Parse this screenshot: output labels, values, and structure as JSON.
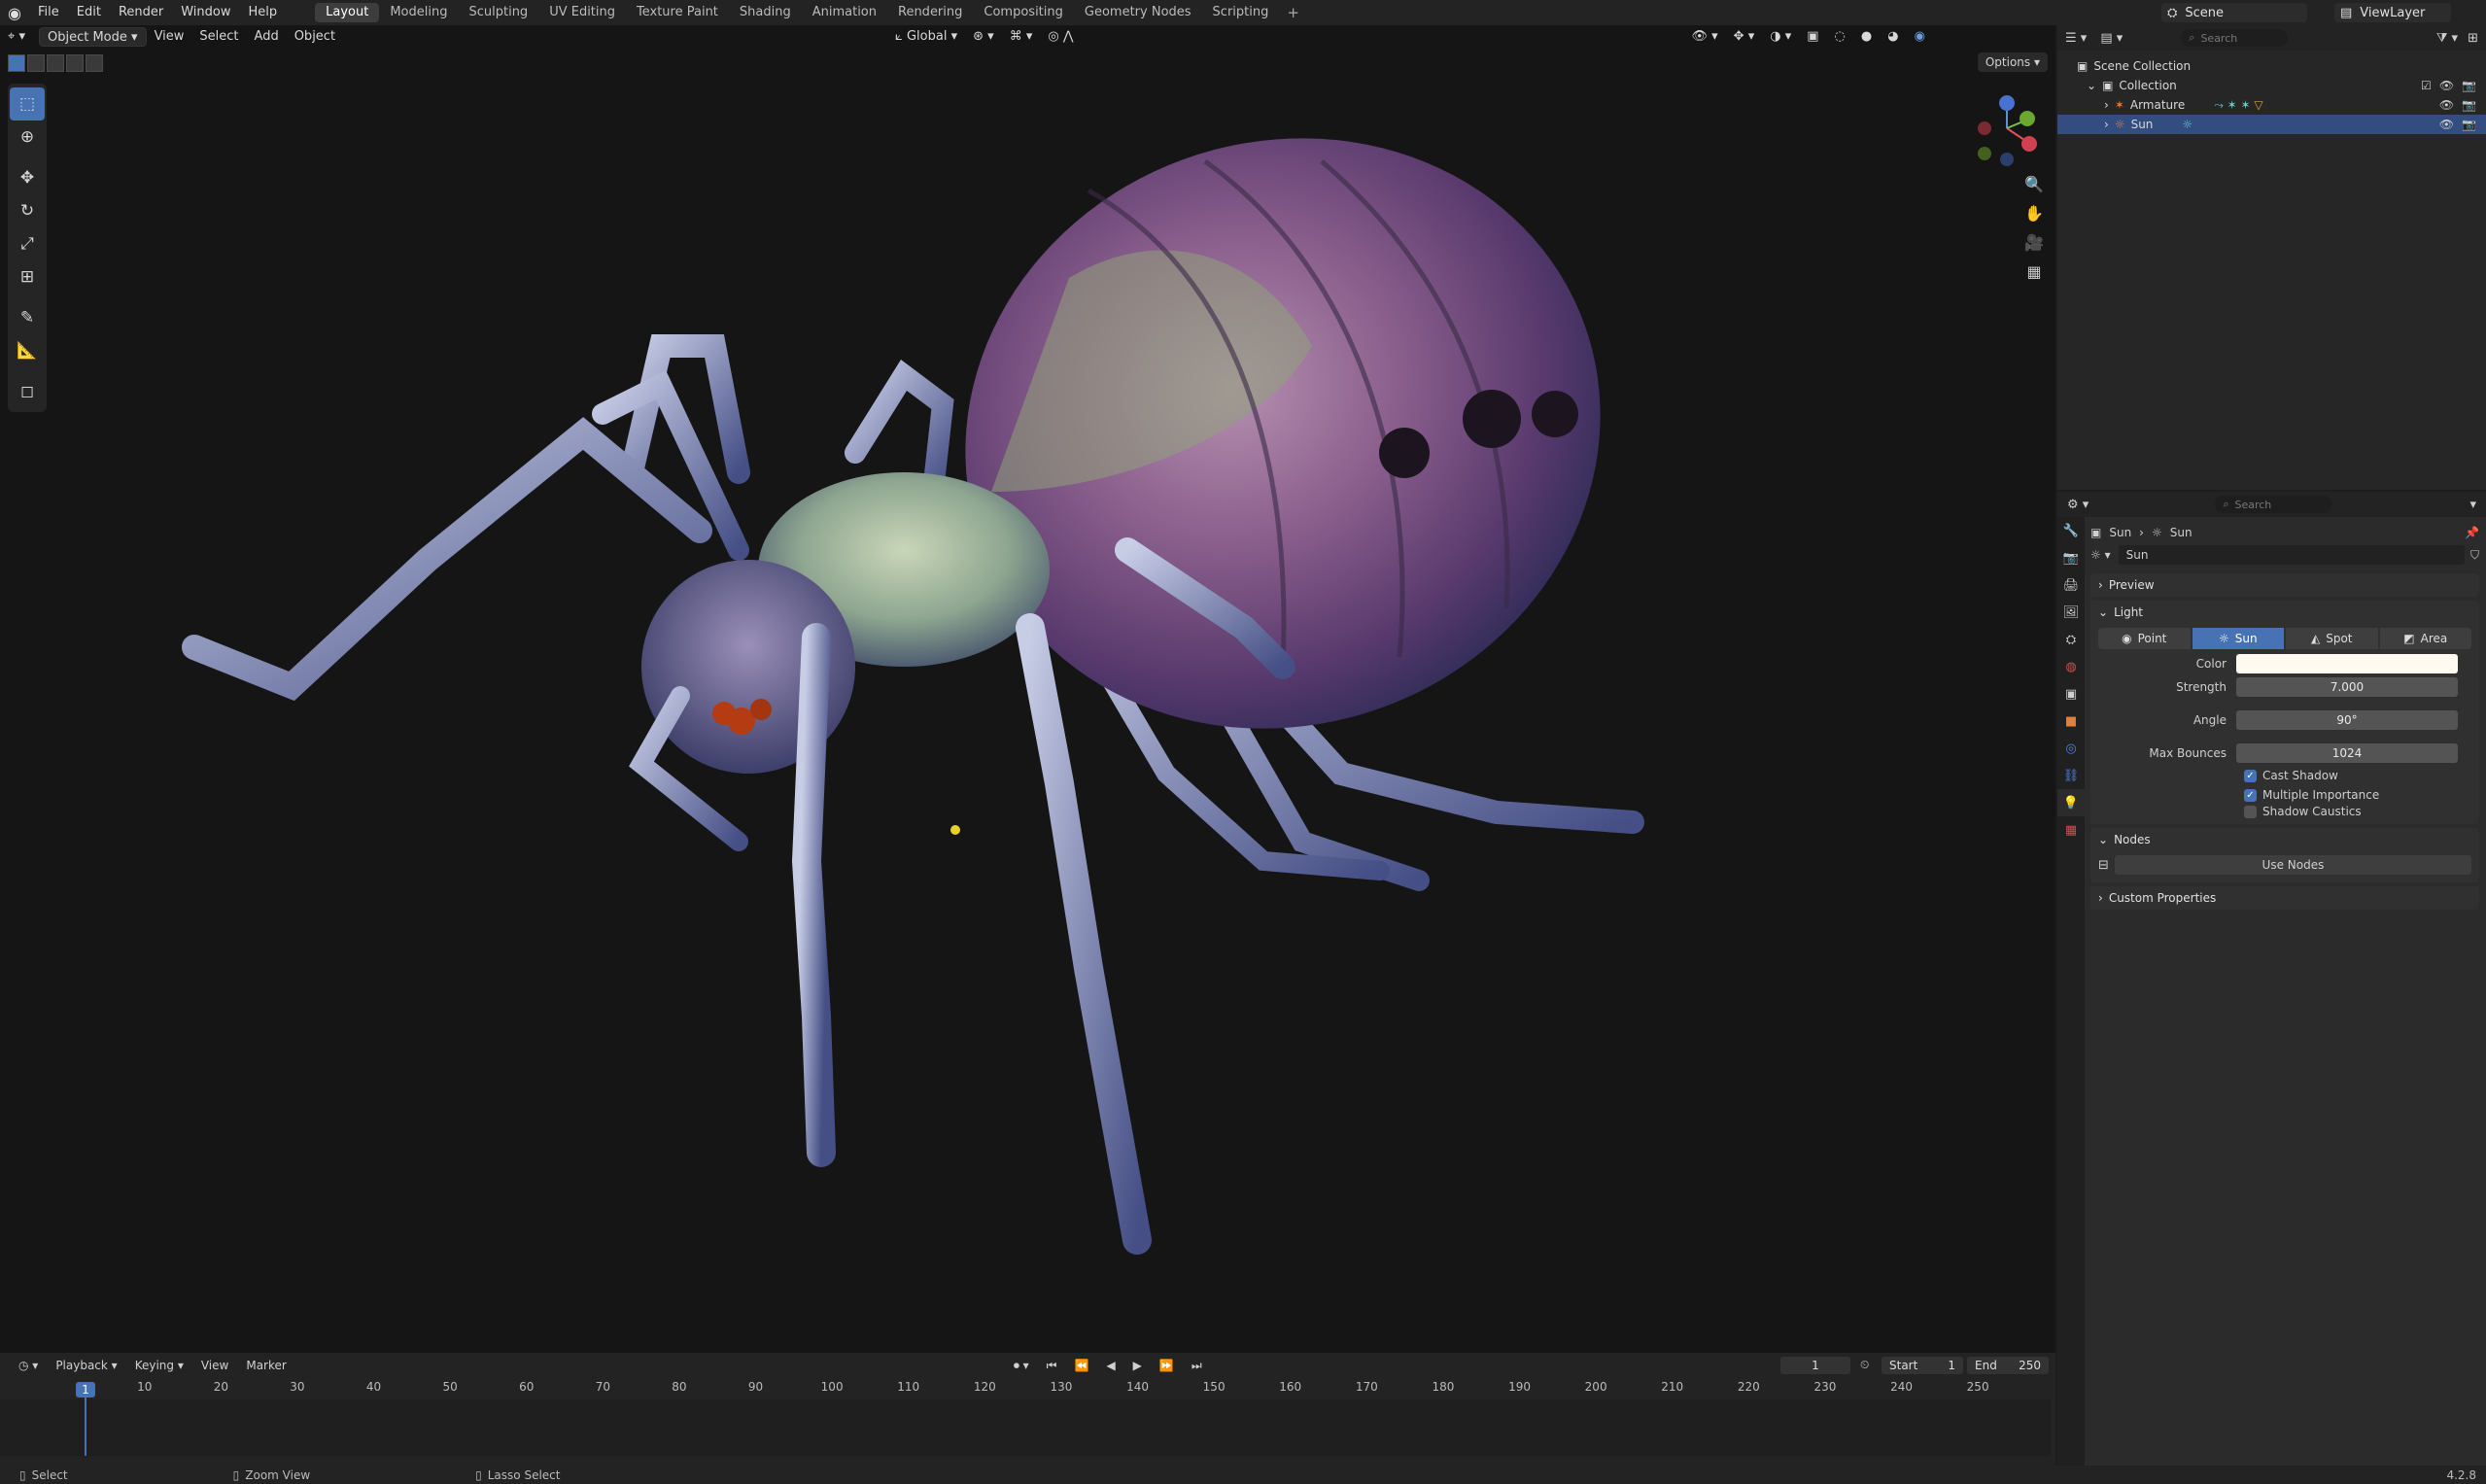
{
  "menu": [
    "File",
    "Edit",
    "Render",
    "Window",
    "Help"
  ],
  "workspaces": [
    "Layout",
    "Modeling",
    "Sculpting",
    "UV Editing",
    "Texture Paint",
    "Shading",
    "Animation",
    "Rendering",
    "Compositing",
    "Geometry Nodes",
    "Scripting"
  ],
  "active_workspace": "Layout",
  "scene_name": "Scene",
  "view_layer": "ViewLayer",
  "viewport": {
    "mode": "Object Mode",
    "menus": [
      "View",
      "Select",
      "Add",
      "Object"
    ],
    "transform_orientation": "Global",
    "options_label": "Options"
  },
  "outliner": {
    "search_placeholder": "Search",
    "rows": [
      {
        "label": "Scene Collection"
      },
      {
        "label": "Collection"
      },
      {
        "label": "Armature"
      },
      {
        "label": "Sun"
      }
    ]
  },
  "properties": {
    "search_placeholder": "Search",
    "breadcrumb": [
      "Sun",
      "Sun"
    ],
    "datablock_name": "Sun",
    "panels": {
      "preview": "Preview",
      "light": "Light",
      "nodes": "Nodes",
      "custom": "Custom Properties"
    },
    "light_types": [
      "Point",
      "Sun",
      "Spot",
      "Area"
    ],
    "active_light_type": "Sun",
    "fields": {
      "color_label": "Color",
      "color_value": "#fffaf0",
      "strength_label": "Strength",
      "strength_value": "7.000",
      "angle_label": "Angle",
      "angle_value": "90°",
      "bounces_label": "Max Bounces",
      "bounces_value": "1024"
    },
    "checks": [
      {
        "label": "Cast Shadow",
        "checked": true
      },
      {
        "label": "Multiple Importance",
        "checked": true
      },
      {
        "label": "Shadow Caustics",
        "checked": false
      }
    ],
    "use_nodes_label": "Use Nodes"
  },
  "timeline": {
    "menus": [
      "Playback",
      "Keying",
      "View",
      "Marker"
    ],
    "current_frame": "1",
    "start_label": "Start",
    "start_value": "1",
    "end_label": "End",
    "end_value": "250",
    "ticks": [
      "10",
      "20",
      "30",
      "40",
      "50",
      "60",
      "70",
      "80",
      "90",
      "100",
      "110",
      "120",
      "130",
      "140",
      "150",
      "160",
      "170",
      "180",
      "190",
      "200",
      "210",
      "220",
      "230",
      "240",
      "250"
    ]
  },
  "status": {
    "select": "Select",
    "zoom": "Zoom View",
    "lasso": "Lasso Select",
    "version": "4.2.8"
  },
  "colors": {
    "accent": "#4772b3",
    "selected_row": "#334d80"
  }
}
